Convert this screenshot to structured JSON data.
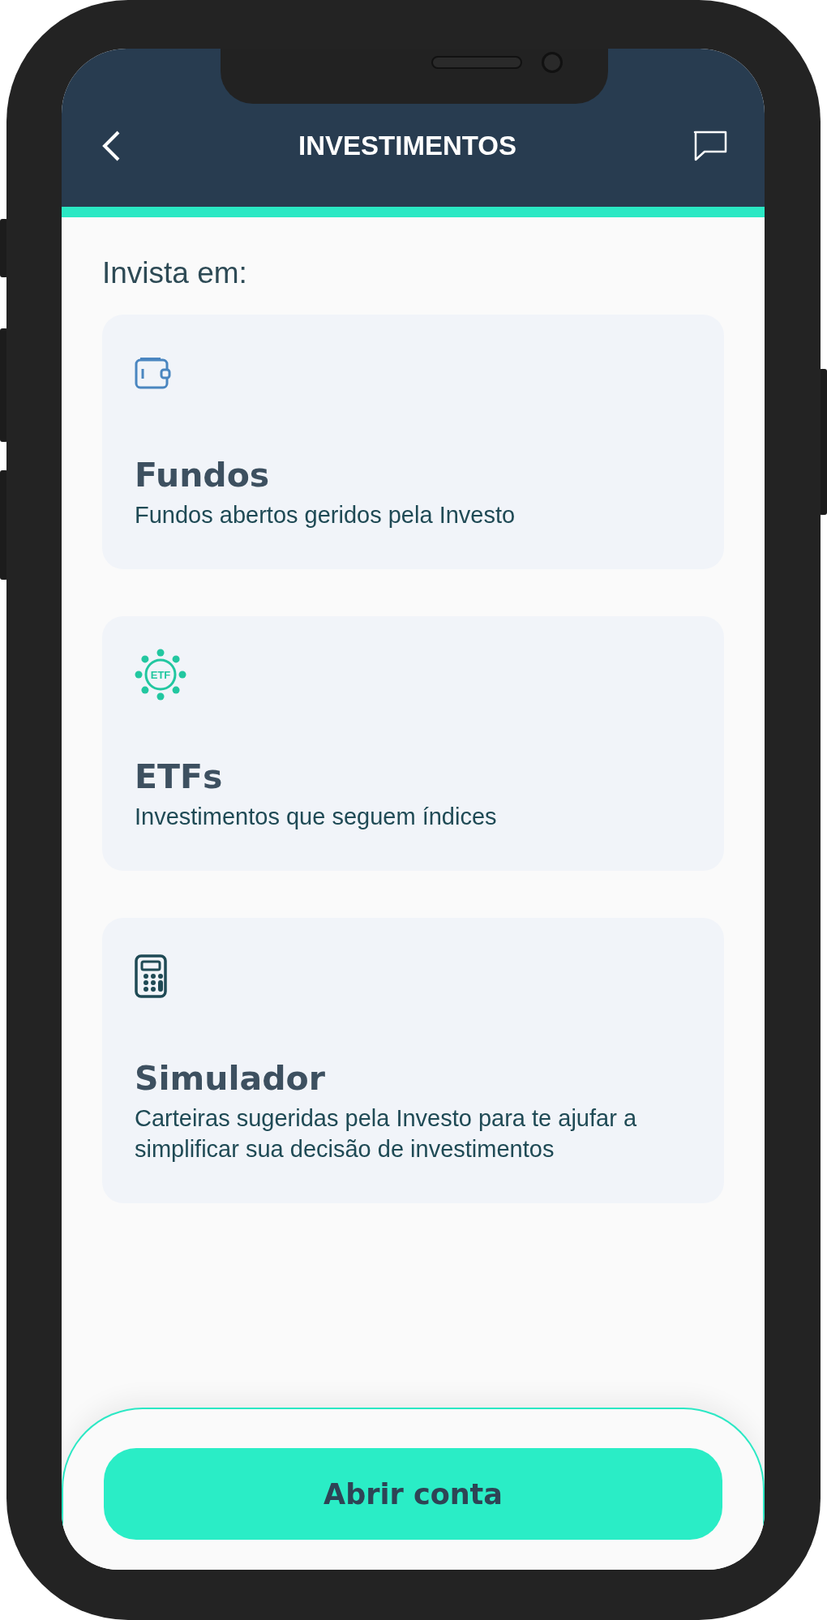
{
  "header": {
    "title": "INVESTIMENTOS"
  },
  "section_title": "Invista em:",
  "cards": [
    {
      "kind": "wallet",
      "title": "Fundos",
      "subtitle": "Fundos abertos geridos pela Investo"
    },
    {
      "kind": "etf",
      "icon_label": "ETF",
      "title": "ETFs",
      "subtitle": "Investimentos que seguem índices"
    },
    {
      "kind": "calculator",
      "title": "Simulador",
      "subtitle": "Carteiras sugeridas pela Investo para te ajufar a simplificar sua decisão de investimentos"
    }
  ],
  "button": {
    "label": "Abrir conta"
  }
}
